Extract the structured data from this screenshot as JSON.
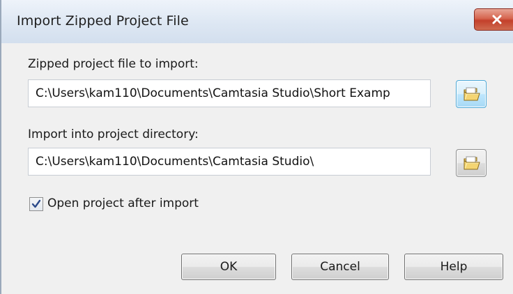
{
  "dialog": {
    "title": "Import Zipped Project File",
    "close_icon": "close-icon"
  },
  "zipped_file": {
    "label": "Zipped project file to import:",
    "value": "C:\\Users\\kam110\\Documents\\Camtasia Studio\\Short Examp",
    "browse_icon": "folder-open-icon"
  },
  "import_dir": {
    "label": "Import into project directory:",
    "value": "C:\\Users\\kam110\\Documents\\Camtasia Studio\\",
    "browse_icon": "folder-open-icon"
  },
  "open_after": {
    "label": "Open project after import",
    "checked": true
  },
  "buttons": {
    "ok": "OK",
    "cancel": "Cancel",
    "help": "Help"
  },
  "colors": {
    "close_red": "#c3402b",
    "titlebar": "#dde7f3",
    "dialog_bg": "#f0f0f0",
    "focus_blue": "#4aa8d8"
  }
}
